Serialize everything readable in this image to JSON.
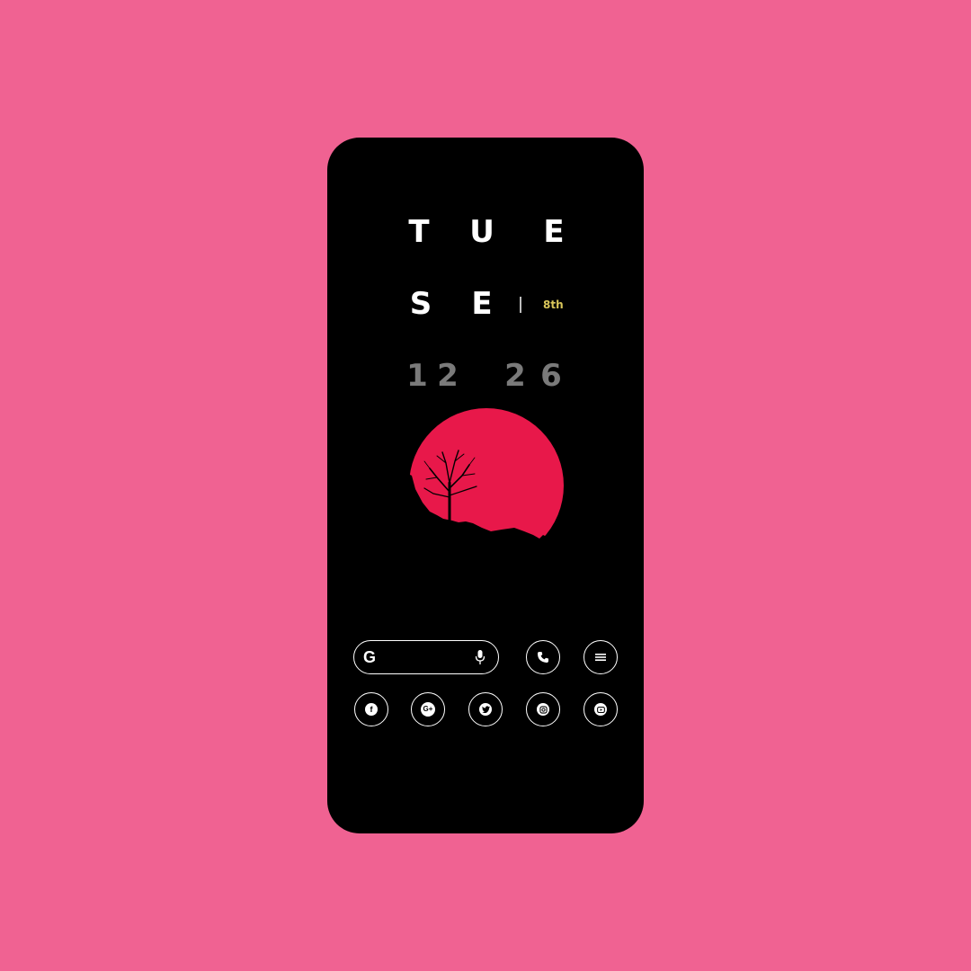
{
  "widget": {
    "day_letters": [
      "T",
      "U",
      "E",
      "S",
      "E"
    ],
    "day_of_month": "8th",
    "time_digits": [
      "1",
      "2",
      "2",
      "6"
    ]
  },
  "colors": {
    "background": "#f06292",
    "sun": "#e8184a",
    "date_accent": "#d9c65a",
    "time_digits": "#7a7a7a"
  },
  "search_bar": {
    "logo": "G",
    "icons": [
      "google-logo-icon",
      "microphone-icon"
    ]
  },
  "dock": {
    "top_row": [
      "phone-icon",
      "menu-icon"
    ],
    "bottom_row": [
      "facebook-icon",
      "google-plus-icon",
      "twitter-icon",
      "instagram-icon",
      "youtube-icon"
    ],
    "glyphs": {
      "facebook": "f",
      "google_plus": "G+"
    }
  }
}
